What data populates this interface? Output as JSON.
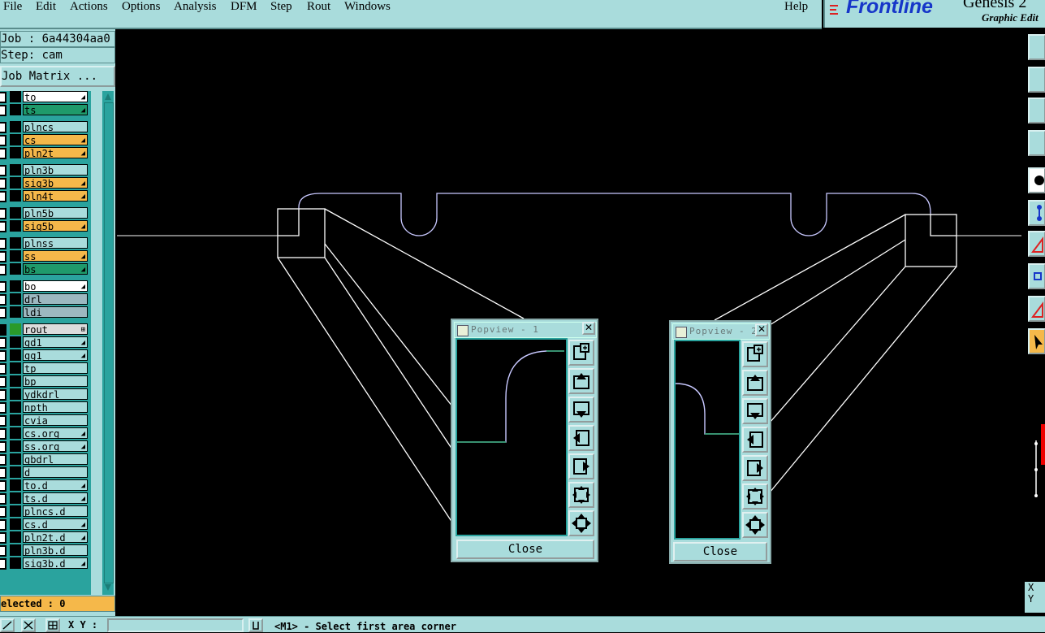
{
  "menubar": {
    "items": [
      "File",
      "Edit",
      "Actions",
      "Options",
      "Analysis",
      "DFM",
      "Step",
      "Rout",
      "Windows"
    ],
    "help": "Help"
  },
  "branding": {
    "logo": "Frontline",
    "product": "Genesis 2",
    "subtitle": "Graphic Edit"
  },
  "job": {
    "job_line": "Job : 6a44304aa0",
    "step_line": "Step: cam",
    "matrix_button": "Job Matrix ..."
  },
  "layers": [
    {
      "name": "to",
      "color": "#ffffff",
      "mark": true
    },
    {
      "name": "ts",
      "color": "#1f9a6b",
      "mark": true
    },
    {
      "name": "plncs",
      "color": "#a9dcdc",
      "mark": false
    },
    {
      "name": "cs",
      "color": "#f5b84a",
      "mark": true
    },
    {
      "name": "pln2t",
      "color": "#f5b84a",
      "mark": true
    },
    {
      "name": "pln3b",
      "color": "#a9dcdc",
      "mark": false
    },
    {
      "name": "sig3b",
      "color": "#f5b84a",
      "mark": true
    },
    {
      "name": "pln4t",
      "color": "#f5b84a",
      "mark": true
    },
    {
      "name": "pln5b",
      "color": "#a9dcdc",
      "mark": false
    },
    {
      "name": "sig5b",
      "color": "#f5b84a",
      "mark": true
    },
    {
      "name": "plnss",
      "color": "#a9dcdc",
      "mark": false
    },
    {
      "name": "ss",
      "color": "#f5b84a",
      "mark": true
    },
    {
      "name": "bs",
      "color": "#1f9a6b",
      "mark": true
    },
    {
      "name": "bo",
      "color": "#ffffff",
      "mark": true
    },
    {
      "name": "drl",
      "color": "#9cb8c0",
      "mark": false
    },
    {
      "name": "ldi",
      "color": "#9cb8c0",
      "mark": false
    },
    {
      "name": "rout",
      "color": "#dcdcdc",
      "mark": true
    },
    {
      "name": "gd1",
      "color": "#a9dcdc",
      "mark": true
    },
    {
      "name": "gg1",
      "color": "#a9dcdc",
      "mark": true
    },
    {
      "name": "tp",
      "color": "#a9dcdc",
      "mark": false
    },
    {
      "name": "bp",
      "color": "#a9dcdc",
      "mark": false
    },
    {
      "name": "ydkdrl",
      "color": "#a9dcdc",
      "mark": false
    },
    {
      "name": "npth",
      "color": "#a9dcdc",
      "mark": false
    },
    {
      "name": "cvia",
      "color": "#a9dcdc",
      "mark": false
    },
    {
      "name": "cs.org",
      "color": "#a9dcdc",
      "mark": true
    },
    {
      "name": "ss.org",
      "color": "#a9dcdc",
      "mark": true
    },
    {
      "name": "gbdrl",
      "color": "#a9dcdc",
      "mark": false
    },
    {
      "name": "d",
      "color": "#a9dcdc",
      "mark": false
    },
    {
      "name": "to.d",
      "color": "#a9dcdc",
      "mark": true
    },
    {
      "name": "ts.d",
      "color": "#a9dcdc",
      "mark": true
    },
    {
      "name": "plncs.d",
      "color": "#a9dcdc",
      "mark": false
    },
    {
      "name": "cs.d",
      "color": "#a9dcdc",
      "mark": true
    },
    {
      "name": "pln2t.d",
      "color": "#a9dcdc",
      "mark": true
    },
    {
      "name": "pln3b.d",
      "color": "#a9dcdc",
      "mark": false
    },
    {
      "name": "sig3b.d",
      "color": "#a9dcdc",
      "mark": true
    }
  ],
  "selected": "elected : 0",
  "popview1": {
    "title": "Popview - 1",
    "close_label": "Close"
  },
  "popview2": {
    "title": "Popview - 2",
    "close_label": "Close"
  },
  "coords": {
    "x_label": "X",
    "y_label": "Y"
  },
  "bottom": {
    "xy_label": "X Y :",
    "xy_value": "",
    "prompt": "<M1> - Select first area corner"
  },
  "colors": {
    "panel": "#a9dcdc",
    "canvas": "#000000",
    "profile_line": "#c8c8ff",
    "outline": "#ffffff",
    "selected_bar": "#f5b84a"
  }
}
